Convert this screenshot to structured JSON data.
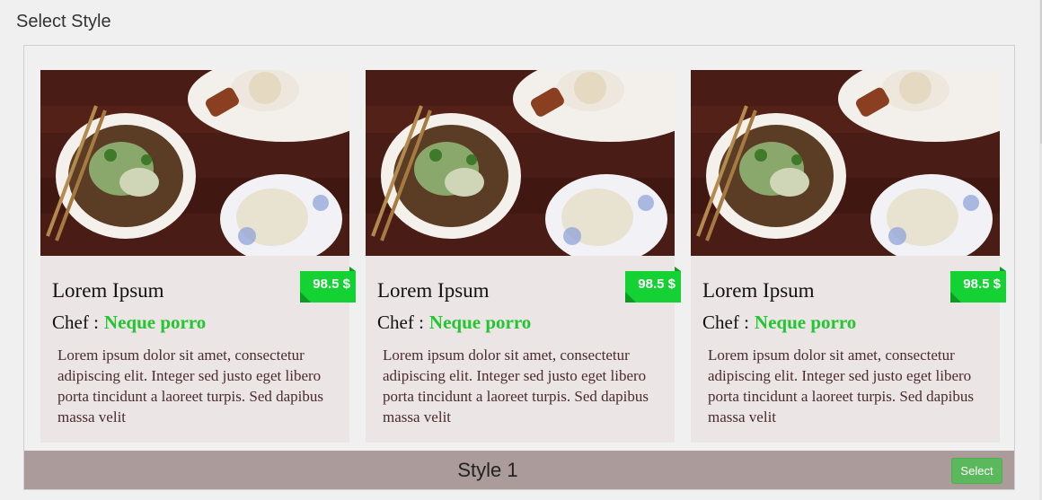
{
  "page": {
    "title": "Select Style"
  },
  "cards": [
    {
      "title": "Lorem Ipsum",
      "price": "98.5 $",
      "chef_label": "Chef :",
      "chef_name": "Neque porro",
      "description": "Lorem ipsum dolor sit amet, consectetur adipiscing elit. Integer sed justo eget libero porta tincidunt a laoreet turpis. Sed dapibus massa velit"
    },
    {
      "title": "Lorem Ipsum",
      "price": "98.5 $",
      "chef_label": "Chef :",
      "chef_name": "Neque porro",
      "description": "Lorem ipsum dolor sit amet, consectetur adipiscing elit. Integer sed justo eget libero porta tincidunt a laoreet turpis. Sed dapibus massa velit"
    },
    {
      "title": "Lorem Ipsum",
      "price": "98.5 $",
      "chef_label": "Chef :",
      "chef_name": "Neque porro",
      "description": "Lorem ipsum dolor sit amet, consectetur adipiscing elit. Integer sed justo eget libero porta tincidunt a laoreet turpis. Sed dapibus massa velit"
    }
  ],
  "footer": {
    "style_label": "Style 1",
    "select_label": "Select"
  },
  "colors": {
    "price_tag": "#14d233",
    "chef_name": "#22c62f",
    "footer_bar": "#ab9b9a",
    "select_button": "#5cb85c"
  }
}
